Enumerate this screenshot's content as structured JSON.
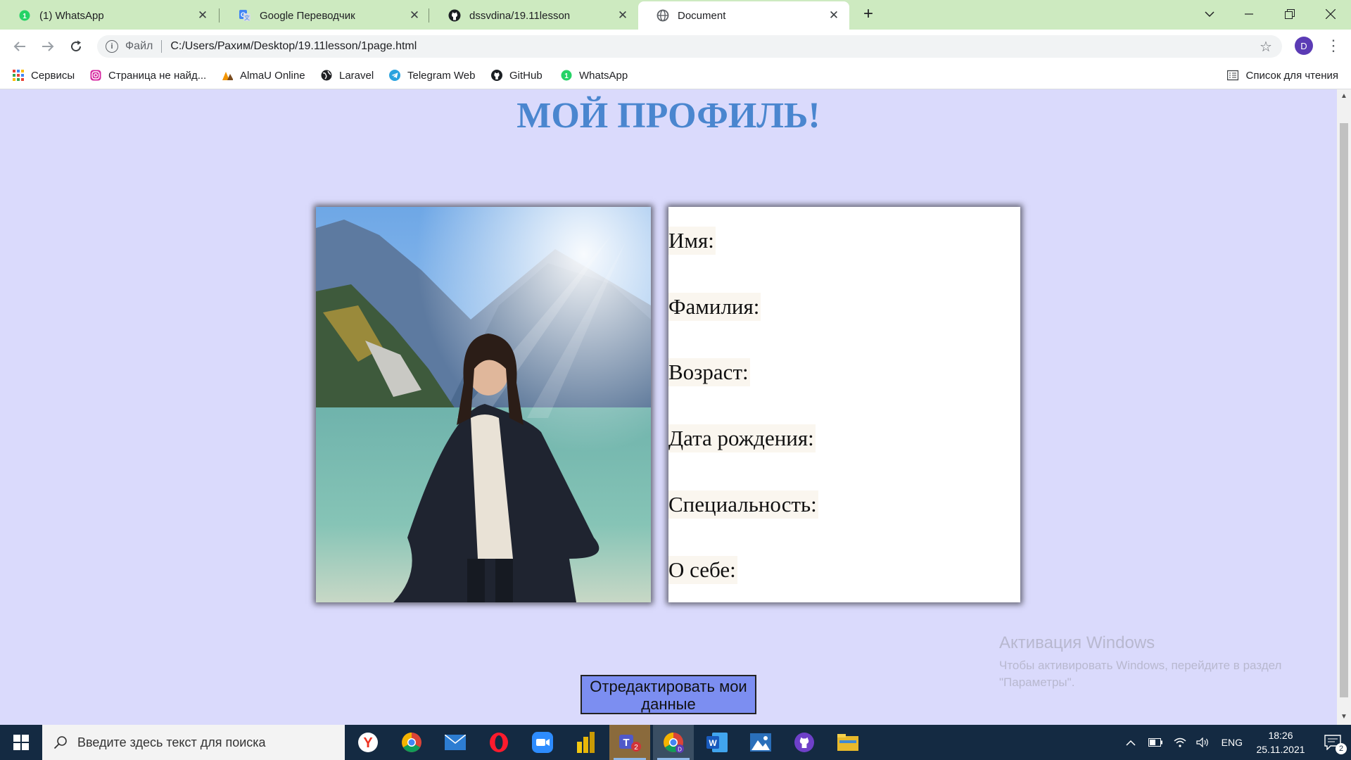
{
  "browser": {
    "tabs": [
      {
        "label": "(1) WhatsApp",
        "icon": "whatsapp-icon"
      },
      {
        "label": "Google Переводчик",
        "icon": "google-translate-icon"
      },
      {
        "label": "dssvdina/19.11lesson",
        "icon": "github-icon"
      },
      {
        "label": "Document",
        "icon": "globe-icon",
        "active": true
      }
    ],
    "url_scheme": "Файл",
    "url": "C:/Users/Рахим/Desktop/19.11lesson/1page.html",
    "profile_initial": "D",
    "bookmarks": [
      {
        "label": "Сервисы",
        "icon": "apps-grid-icon"
      },
      {
        "label": "Страница не найд...",
        "icon": "instagram-icon"
      },
      {
        "label": "AlmaU Online",
        "icon": "almau-icon"
      },
      {
        "label": "Laravel",
        "icon": "globe-icon"
      },
      {
        "label": "Telegram Web",
        "icon": "telegram-icon"
      },
      {
        "label": "GitHub",
        "icon": "github-icon"
      },
      {
        "label": "WhatsApp",
        "icon": "whatsapp-icon"
      }
    ],
    "reading_list": "Список для чтения"
  },
  "page": {
    "title": "МОЙ ПРОФИЛЬ!",
    "fields": [
      "Имя:",
      "Фамилия:",
      "Возраст:",
      "Дата рождения:",
      "Специальность:",
      "О себе:"
    ],
    "edit_button_label": "Отредактировать мои данные"
  },
  "watermark": {
    "title": "Активация Windows",
    "subtitle": "Чтобы активировать Windows, перейдите в раздел \"Параметры\"."
  },
  "taskbar": {
    "search_placeholder": "Введите здесь текст для поиска",
    "language": "ENG",
    "time": "18:26",
    "date": "25.11.2021",
    "notification_count": "2",
    "teams_badge": "2"
  },
  "colors": {
    "tab_strip": "#cdeac0",
    "page_background": "#dadafc",
    "title_color": "#4a86cf",
    "button_background": "#7c8ef1",
    "taskbar": "#142a42"
  }
}
